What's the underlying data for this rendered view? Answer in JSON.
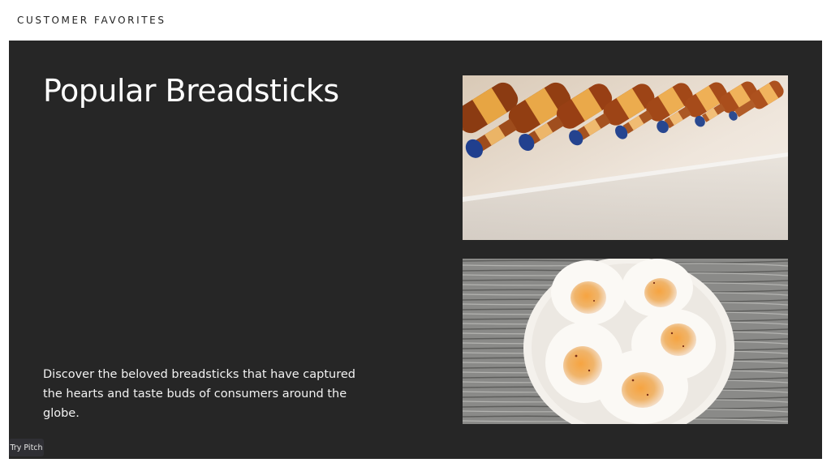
{
  "header": {
    "label": "CUSTOMER FAVORITES"
  },
  "slide": {
    "title": "Popular Breadsticks",
    "description": "Discover the beloved breadsticks that have captured the hearts and taste buds of consumers around the globe."
  },
  "badge": {
    "label": "Try Pitch"
  },
  "colors": {
    "panel": "#262626",
    "page": "#ffffff",
    "text": "#ffffff"
  }
}
